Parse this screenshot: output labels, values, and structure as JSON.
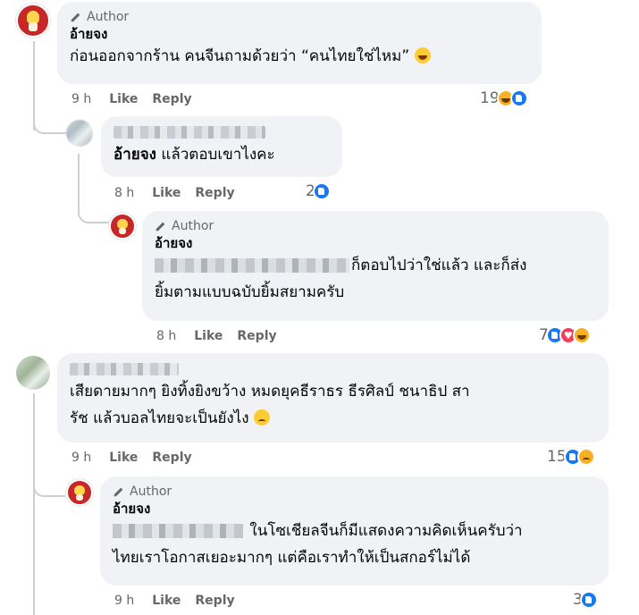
{
  "author_tag": "Author",
  "comments": [
    {
      "name": "อ้ายจง",
      "line1": "ก่อนออกจากร้าน คนจีนถามด้วยว่า “คนไทยใช่ไหม”",
      "emoji": "laughing-tears-emoji",
      "time": "9 h",
      "like": "Like",
      "reply": "Reply",
      "reaction_count": "19",
      "reactions": [
        "haha",
        "like"
      ]
    },
    {
      "name_blurred": true,
      "mention": "อ้ายจง",
      "line1": " แล้วตอบเขาไงคะ",
      "time": "8 h",
      "like": "Like",
      "reply": "Reply",
      "reaction_count": "2",
      "reactions": [
        "like"
      ]
    },
    {
      "name": "อ้ายจง",
      "line1": "ก็ตอบไปว่าใช่แล้ว และก็ส่ง",
      "line2": "ยิ้มตามแบบฉบับยิ้มสยามครับ",
      "time": "8 h",
      "like": "Like",
      "reply": "Reply",
      "reaction_count": "7",
      "reactions": [
        "like",
        "love",
        "haha"
      ]
    },
    {
      "name_blurred": true,
      "line1": "เสียดายมากๆ ยิงทิ้งยิงขว้าง หมดยุคธีราธร ธีรศิลป์ ชนาธิป สา",
      "line2": "รัช แล้วบอลไทยจะเป็นยังไง",
      "emoji": "sad-emoji",
      "time": "9 h",
      "like": "Like",
      "reply": "Reply",
      "reaction_count": "15",
      "reactions": [
        "like",
        "sad"
      ]
    },
    {
      "name": "อ้ายจง",
      "line1": " ในโซเชียลจีนก็มีแสดงความคิดเห็นครับว่า",
      "line2": "ไทยเราโอกาสเยอะมากๆ แต่คือเราทำให้เป็นสกอร์ไม่ได้",
      "time": "9 h",
      "like": "Like",
      "reply": "Reply",
      "reaction_count": "3",
      "reactions": [
        "like"
      ]
    }
  ]
}
